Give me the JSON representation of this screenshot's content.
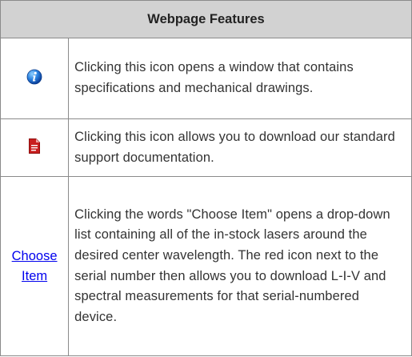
{
  "table": {
    "header": "Webpage Features",
    "rows": [
      {
        "icon": "info-icon",
        "description": "Clicking this icon opens a window that contains specifications and mechanical drawings."
      },
      {
        "icon": "document-download-icon",
        "description": "Clicking this icon allows you to download our standard support documentation."
      },
      {
        "link": "Choose Item",
        "description": "Clicking the words \"Choose Item\" opens a drop-down list containing all of the in-stock lasers around the desired center wavelength. The red icon next to the serial number then allows you to download L-I-V and spectral measurements for that serial-numbered device."
      }
    ]
  },
  "colors": {
    "header_bg": "#d2d2d2",
    "border": "#8a8a8a",
    "link": "#0000ee",
    "info_icon": "#1a6fd6",
    "doc_icon": "#c81e1e"
  }
}
